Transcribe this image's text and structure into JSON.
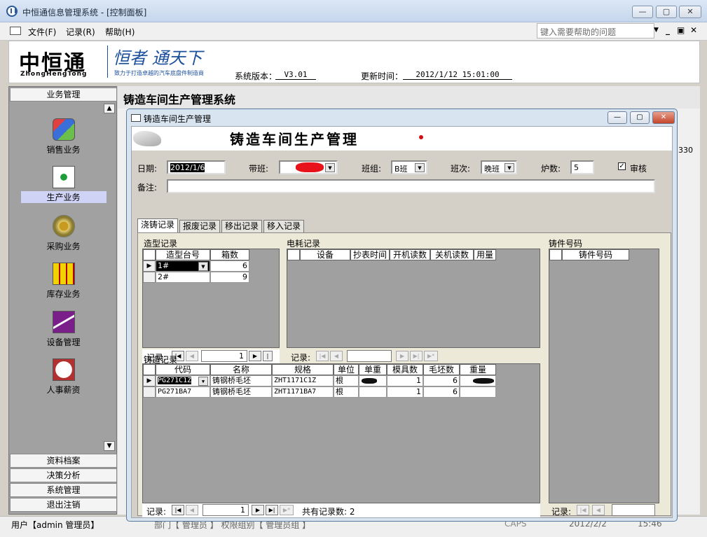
{
  "window": {
    "title": "中恒通信息管理系统 - [控制面板]",
    "min": "—",
    "max": "▢",
    "close": "✕"
  },
  "menu": {
    "file": "文件(F)",
    "record": "记录(R)",
    "help": "帮助(H)",
    "help_placeholder": "键入需要帮助的问题"
  },
  "header": {
    "logo_cn": "中恒通",
    "logo_en": "ZhongHengTong",
    "slogan": "恒者 通天下",
    "slogan_sub": "致力于打造卓越的汽车底盘件制造商",
    "version_label": "系统版本：",
    "version_value": "V3.01",
    "update_label": "更新时间：",
    "update_value": "2012/1/12 15:01:00"
  },
  "sidebar": {
    "top_header": "业务管理",
    "items": [
      {
        "label": "销售业务",
        "icon": "cubes-icon"
      },
      {
        "label": "生产业务",
        "icon": "grid-dots-icon"
      },
      {
        "label": "采购业务",
        "icon": "gears-icon"
      },
      {
        "label": "库存业务",
        "icon": "org-chart-icon"
      },
      {
        "label": "设备管理",
        "icon": "line-chart-icon"
      },
      {
        "label": "人事薪资",
        "icon": "clock-icon"
      }
    ],
    "bottom_headers": [
      "资料档案",
      "决策分析",
      "系统管理",
      "退出注销"
    ]
  },
  "main": {
    "title": "铸造车间生产管理系统"
  },
  "status": {
    "user": "用户【admin 管理员】",
    "dept": "部门【 管理员 】 权限组别【 管理员组 】",
    "date": "2012/2/2",
    "time": "15:46",
    "caps": "CAPS",
    "side_num": "330"
  },
  "dialog": {
    "title": "铸造车间生产管理",
    "banner": "铸造车间生产管理",
    "date_label": "日期:",
    "date_value": "2012/1/6",
    "shift_leader_label": "带班:",
    "team_label": "班组:",
    "team_value": "B班",
    "shift_label": "班次:",
    "shift_value": "晚班",
    "furnace_label": "炉数:",
    "furnace_value": "5",
    "audit_label": "审核",
    "audit_checked": "✓",
    "remark_label": "备注:",
    "remark_value": "",
    "tabs": [
      "浇铸记录",
      "报废记录",
      "移出记录",
      "移入记录"
    ],
    "mold": {
      "label": "造型记录",
      "headers": [
        "造型台号",
        "箱数"
      ],
      "rows": [
        {
          "no": "1#",
          "count": "6"
        },
        {
          "no": "2#",
          "count": "9"
        }
      ],
      "nav_label": "记录:",
      "nav_value": "1"
    },
    "power": {
      "label": "电耗记录",
      "headers": [
        "设备",
        "抄表时间",
        "开机读数",
        "关机读数",
        "用量"
      ],
      "nav_label": "记录:",
      "nav_value": ""
    },
    "part_no": {
      "label": "铸件号码",
      "headers": [
        "铸件号码"
      ],
      "nav_label": "记录:",
      "nav_value": ""
    },
    "casting": {
      "label": "铸造记录",
      "headers": [
        "代码",
        "名称",
        "规格",
        "单位",
        "单重",
        "模具数",
        "毛坯数",
        "重量"
      ],
      "rows": [
        {
          "code": "PG271C1Z",
          "name": "铸钢桥毛坯",
          "spec": "ZHT1171C1Z",
          "unit": "根",
          "unit_weight": "",
          "molds": "1",
          "blanks": "6",
          "weight": ""
        },
        {
          "code": "PG271BA7",
          "name": "铸钢桥毛坯",
          "spec": "ZHT1171BA7",
          "unit": "根",
          "unit_weight": "",
          "molds": "1",
          "blanks": "6",
          "weight": ""
        }
      ],
      "nav_label": "记录:",
      "nav_value": "1",
      "total_label": "共有记录数: 2"
    }
  },
  "nav_glyphs": {
    "first": "|◀",
    "prev": "◀",
    "next": "▶",
    "last": "▶|",
    "new": "▶*"
  }
}
